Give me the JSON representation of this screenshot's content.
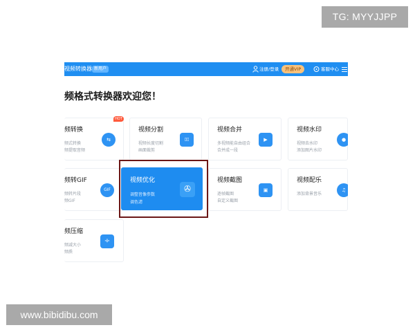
{
  "watermarks": {
    "top_right": "TG: MYYJJPP",
    "bottom_left": "www.bibidibu.com"
  },
  "app": {
    "name": "视频转换器",
    "badge": "新用户",
    "login": "注册/登录",
    "vip": "开通VIP",
    "help": "客服中心"
  },
  "welcome": "频格式转换器欢迎您！",
  "hot_label": "HOT",
  "cards": [
    {
      "title": "频转换",
      "d1": "频式转换",
      "d2": "频提取音频",
      "icon": "⇆"
    },
    {
      "title": "视频分割",
      "d1": "视频长度切割",
      "d2": "画面裁剪",
      "icon": "▯▯"
    },
    {
      "title": "视频合并",
      "d1": "多视频能自由组合",
      "d2": "合并成一段",
      "icon": "▶"
    },
    {
      "title": "视频水印",
      "d1": "视频去水印",
      "d2": "添加图片水印",
      "icon": "●"
    },
    {
      "title": "频转GIF",
      "d1": "频转片段",
      "d2": "频GIF",
      "icon": "GIF"
    },
    {
      "title": "视频优化",
      "d1": "调整音像参数",
      "d2": "调色滤",
      "icon": "✇"
    },
    {
      "title": "视频截图",
      "d1": "逐帧截图",
      "d2": "自定义截图",
      "icon": "▣"
    },
    {
      "title": "视频配乐",
      "d1": "添加背景音乐",
      "d2": "",
      "icon": "♫"
    },
    {
      "title": "频压缩",
      "d1": "频减大小",
      "d2": "频质",
      "icon": "÷"
    }
  ],
  "colors": {
    "accent": "#1f8ef1",
    "highlight_border": "#6b1616",
    "hot": "#ff5a3c",
    "vip": "#f9c27b"
  }
}
